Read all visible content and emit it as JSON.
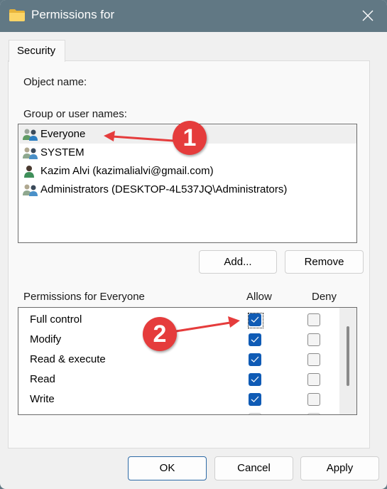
{
  "window": {
    "title": "Permissions for",
    "title_icon": "folder-icon",
    "close_icon": "close-icon"
  },
  "tabs": [
    {
      "label": "Security",
      "active": true
    }
  ],
  "object_name": {
    "label": "Object name:",
    "value": ""
  },
  "group_list": {
    "label": "Group or user names:",
    "items": [
      {
        "name": "Everyone",
        "icon": "group-users-icon",
        "selected": true
      },
      {
        "name": "SYSTEM",
        "icon": "group-users-icon",
        "selected": false
      },
      {
        "name": "Kazim Alvi (kazimalialvi@gmail.com)",
        "icon": "user-icon",
        "selected": false
      },
      {
        "name": "Administrators (DESKTOP-4L537JQ\\Administrators)",
        "icon": "group-users-icon",
        "selected": false
      }
    ]
  },
  "buttons": {
    "add": "Add...",
    "remove": "Remove",
    "ok": "OK",
    "cancel": "Cancel",
    "apply": "Apply"
  },
  "permissions": {
    "label": "Permissions for Everyone",
    "allow_header": "Allow",
    "deny_header": "Deny",
    "rows": [
      {
        "name": "Full control",
        "allow": true,
        "deny": false,
        "focused": true
      },
      {
        "name": "Modify",
        "allow": true,
        "deny": false
      },
      {
        "name": "Read & execute",
        "allow": true,
        "deny": false
      },
      {
        "name": "Read",
        "allow": true,
        "deny": false
      },
      {
        "name": "Write",
        "allow": true,
        "deny": false
      }
    ]
  },
  "annotations": [
    {
      "number": "1",
      "target": "Everyone"
    },
    {
      "number": "2",
      "target": "Full control allow checkbox"
    }
  ],
  "colors": {
    "titlebar": "#617884",
    "accent": "#0f5bb5",
    "callout": "#e53c3c"
  }
}
